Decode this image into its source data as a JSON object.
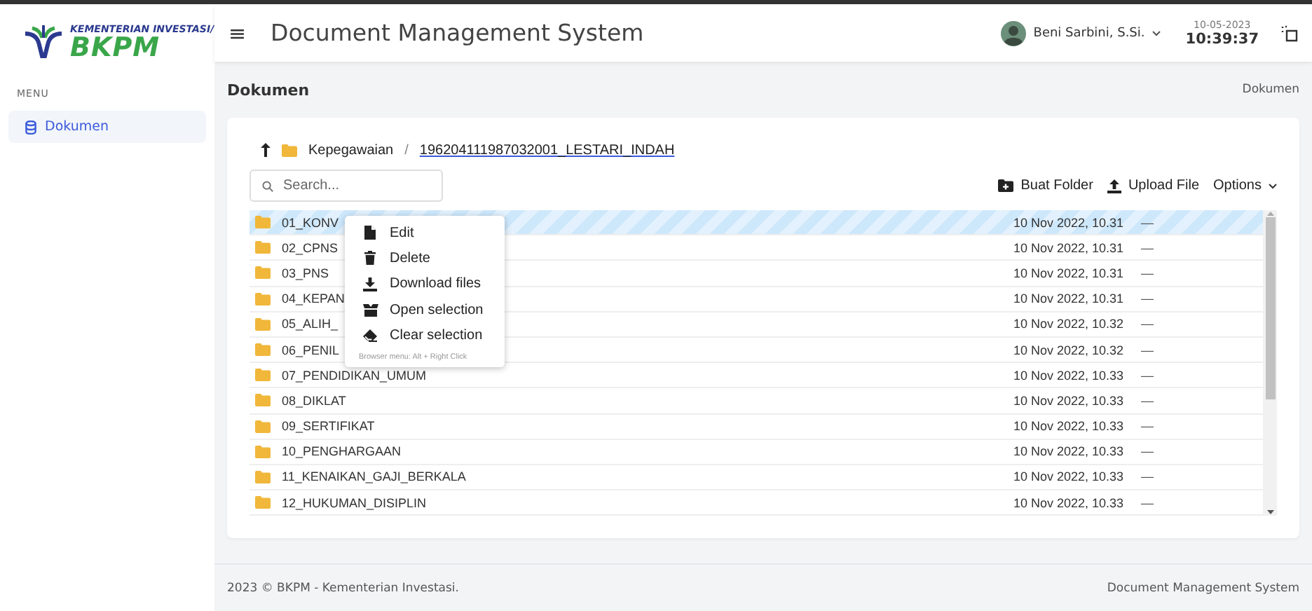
{
  "brand": {
    "line1": "KEMENTERIAN INVESTASI/",
    "line2": "BKPM"
  },
  "sidebar": {
    "heading": "MENU",
    "items": [
      {
        "label": "Dokumen",
        "selected": true
      }
    ]
  },
  "header": {
    "menu_glyph": "≡",
    "title": "Document Management System",
    "user": "Beni Sarbini, S.Si.",
    "date": "10-05-2023",
    "time": "10:39:37"
  },
  "page": {
    "title": "Dokumen",
    "breadcrumb": "Dokumen"
  },
  "browser": {
    "path": [
      {
        "label": "Kepegawaian",
        "kind": "plain"
      },
      {
        "label": "196204111987032001_LESTARI_INDAH",
        "kind": "link"
      }
    ],
    "separator": "/",
    "search": {
      "placeholder": "Search..."
    },
    "actions": [
      {
        "label": "Buat Folder",
        "kind": "folder"
      },
      {
        "label": "Upload File",
        "kind": "upload"
      },
      {
        "label": "Options",
        "kind": "dropdown"
      }
    ],
    "rows": [
      {
        "name": "01_KONV",
        "date": "10 Nov 2022, 10.31",
        "size": "—",
        "selected": true
      },
      {
        "name": "02_CPNS",
        "date": "10 Nov 2022, 10.31",
        "size": "—",
        "selected": false
      },
      {
        "name": "03_PNS",
        "date": "10 Nov 2022, 10.31",
        "size": "—",
        "selected": false
      },
      {
        "name": "04_KEPAN",
        "date": "10 Nov 2022, 10.31",
        "size": "—",
        "selected": false
      },
      {
        "name": "05_ALIH_",
        "date": "10 Nov 2022, 10.32",
        "size": "—",
        "selected": false
      },
      {
        "name": "06_PENIL",
        "date": "10 Nov 2022, 10.32",
        "size": "—",
        "selected": false
      },
      {
        "name": "07_PENDIDIKAN_UMUM",
        "date": "10 Nov 2022, 10.33",
        "size": "—",
        "selected": false
      },
      {
        "name": "08_DIKLAT",
        "date": "10 Nov 2022, 10.33",
        "size": "—",
        "selected": false
      },
      {
        "name": "09_SERTIFIKAT",
        "date": "10 Nov 2022, 10.33",
        "size": "—",
        "selected": false
      },
      {
        "name": "10_PENGHARGAAN",
        "date": "10 Nov 2022, 10.33",
        "size": "—",
        "selected": false
      },
      {
        "name": "11_KENAIKAN_GAJI_BERKALA",
        "date": "10 Nov 2022, 10.33",
        "size": "—",
        "selected": false
      },
      {
        "name": "12_HUKUMAN_DISIPLIN",
        "date": "10 Nov 2022, 10.33",
        "size": "—",
        "selected": false
      }
    ],
    "context_menu": {
      "items": [
        {
          "label": "Edit",
          "kind": "edit"
        },
        {
          "label": "Delete",
          "kind": "delete"
        },
        {
          "label": "Download files",
          "kind": "download"
        },
        {
          "label": "Open selection",
          "kind": "open"
        },
        {
          "label": "Clear selection",
          "kind": "clear"
        }
      ],
      "hint": "Browser menu: Alt + Right Click"
    }
  },
  "footer": {
    "left": "2023 © BKPM - Kementerian Investasi.",
    "right": "Document Management System"
  }
}
